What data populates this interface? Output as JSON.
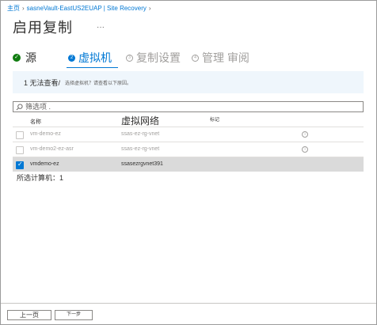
{
  "breadcrumb": {
    "home": "主页",
    "vault": "sasneVault-EastUS2EUAP | Site Recovery"
  },
  "header": {
    "title": "启用复制",
    "more": "···"
  },
  "steps": [
    {
      "label": "源",
      "state": "done"
    },
    {
      "number": "2",
      "label": "虚拟机",
      "state": "active"
    },
    {
      "number": "3",
      "label": "复制设置",
      "state": "pending"
    },
    {
      "number": "4",
      "label": "管理 审阅",
      "state": "pending"
    }
  ],
  "info_bar": {
    "primary": "1 无法查看/",
    "secondary": "选择虚拟机？请查看以下原因。"
  },
  "filter": {
    "placeholder": "筛选项 ."
  },
  "table": {
    "headers": {
      "name": "名称",
      "vnet": "虚拟网络",
      "tag": "标记"
    },
    "rows": [
      {
        "name": "vm-demo-ez",
        "vnet": "ssas-ez-rg-vnet",
        "selected": false,
        "disabled": true
      },
      {
        "name": "vm-demo2-ez-asr",
        "vnet": "ssas-ez-rg-vnet",
        "selected": false,
        "disabled": true
      },
      {
        "name": "vmdemo-ez",
        "vnet": "ssasezrgvnet391",
        "selected": true,
        "disabled": false
      }
    ]
  },
  "selected_count": "所选计算机：1",
  "footer": {
    "prev_label": "上一页",
    "next_label": "下一步"
  },
  "colors": {
    "accent": "#0078d4",
    "success": "#107c10",
    "info_bg": "#eff6fc",
    "selected_row": "#dadada"
  }
}
